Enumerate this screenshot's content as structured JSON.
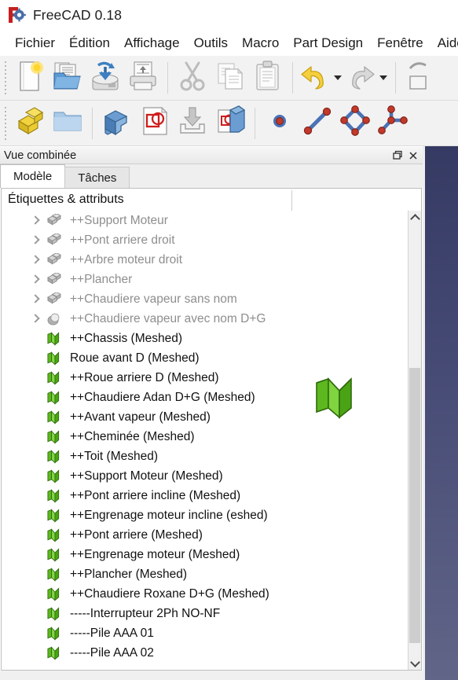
{
  "window": {
    "title": "FreeCAD 0.18",
    "logo_icon": "freecad-logo-icon"
  },
  "menubar": {
    "items": [
      {
        "label": "Fichier"
      },
      {
        "label": "Édition"
      },
      {
        "label": "Affichage"
      },
      {
        "label": "Outils"
      },
      {
        "label": "Macro"
      },
      {
        "label": "Part Design"
      },
      {
        "label": "Fenêtre"
      },
      {
        "label": "Aide"
      }
    ]
  },
  "toolbars": [
    {
      "name": "file-toolbar",
      "buttons": [
        {
          "icon": "new-document-icon",
          "label": "Nouveau",
          "enabled": true
        },
        {
          "icon": "open-folder-icon",
          "label": "Ouvrir",
          "enabled": true
        },
        {
          "icon": "save-disk-icon",
          "label": "Enregistrer",
          "enabled": true
        },
        {
          "icon": "print-icon",
          "label": "Imprimer",
          "enabled": true
        },
        {
          "icon": "cut-scissors-icon",
          "label": "Couper",
          "enabled": false
        },
        {
          "icon": "copy-pages-icon",
          "label": "Copier",
          "enabled": false
        },
        {
          "icon": "paste-clipboard-icon",
          "label": "Coller",
          "enabled": false
        },
        {
          "icon": "undo-arrow-icon",
          "label": "Annuler",
          "enabled": true,
          "dropdown": true
        },
        {
          "icon": "redo-arrow-icon",
          "label": "Rétablir",
          "enabled": false,
          "dropdown": true
        },
        {
          "icon": "refresh-icon",
          "label": "Rafraîchir",
          "enabled": true,
          "clipped": true
        }
      ]
    },
    {
      "name": "workbench-toolbar",
      "buttons": [
        {
          "icon": "yellow-blocks-icon",
          "label": "Créer un corps",
          "enabled": true
        },
        {
          "icon": "blue-folder-icon",
          "label": "Créer un groupe",
          "enabled": true
        },
        {
          "icon": "blue-part-icon",
          "label": "Pièce",
          "enabled": true
        },
        {
          "icon": "sketch-document-icon",
          "label": "Créer une esquisse",
          "enabled": true
        },
        {
          "icon": "import-arrow-icon",
          "label": "Importer",
          "enabled": false
        },
        {
          "icon": "attach-sketch-icon",
          "label": "Attacher une esquisse",
          "enabled": true
        },
        {
          "icon": "point-icon",
          "label": "Point",
          "enabled": true
        },
        {
          "icon": "line-icon",
          "label": "Ligne",
          "enabled": true
        },
        {
          "icon": "polyline-icon",
          "label": "Polyligne",
          "enabled": true
        },
        {
          "icon": "three-point-icon",
          "label": "Arc trois points",
          "enabled": true
        }
      ]
    }
  ],
  "panel": {
    "title": "Vue combinée",
    "float_icon": "restore-icon",
    "close_icon": "close-icon",
    "tabs": [
      {
        "label": "Modèle",
        "active": true
      },
      {
        "label": "Tâches",
        "active": false
      }
    ]
  },
  "tree": {
    "column_header": "Étiquettes & attributs",
    "items": [
      {
        "label": "++Support Moteur",
        "icon": "part-cube-icon",
        "state": "dim",
        "expandable": true
      },
      {
        "label": "++Pont arriere droit",
        "icon": "part-cube-icon",
        "state": "dim",
        "expandable": true
      },
      {
        "label": "++Arbre moteur droit",
        "icon": "part-cube-icon",
        "state": "dim",
        "expandable": true
      },
      {
        "label": "++Plancher",
        "icon": "part-cube-icon",
        "state": "dim",
        "expandable": true
      },
      {
        "label": "++Chaudiere vapeur sans nom",
        "icon": "part-cube-icon",
        "state": "dim",
        "expandable": true
      },
      {
        "label": "++Chaudiere vapeur avec nom D+G",
        "icon": "part-sphere-icon",
        "state": "dim",
        "expandable": true
      },
      {
        "label": "++Chassis (Meshed)",
        "icon": "mesh-icon",
        "state": "normal",
        "expandable": false
      },
      {
        "label": "Roue avant D (Meshed)",
        "icon": "mesh-icon",
        "state": "normal",
        "expandable": false
      },
      {
        "label": "++Roue arriere D (Meshed)",
        "icon": "mesh-icon",
        "state": "normal",
        "expandable": false
      },
      {
        "label": "++Chaudiere Adan D+G (Meshed)",
        "icon": "mesh-icon",
        "state": "normal",
        "expandable": false
      },
      {
        "label": "++Avant vapeur (Meshed)",
        "icon": "mesh-icon",
        "state": "normal",
        "expandable": false
      },
      {
        "label": "++Cheminée (Meshed)",
        "icon": "mesh-icon",
        "state": "normal",
        "expandable": false
      },
      {
        "label": "++Toit (Meshed)",
        "icon": "mesh-icon",
        "state": "normal",
        "expandable": false
      },
      {
        "label": "++Support Moteur (Meshed)",
        "icon": "mesh-icon",
        "state": "normal",
        "expandable": false
      },
      {
        "label": "++Pont arriere incline (Meshed)",
        "icon": "mesh-icon",
        "state": "normal",
        "expandable": false
      },
      {
        "label": "++Engrenage moteur incline (eshed)",
        "icon": "mesh-icon",
        "state": "normal",
        "expandable": false
      },
      {
        "label": "++Pont arriere (Meshed)",
        "icon": "mesh-icon",
        "state": "normal",
        "expandable": false
      },
      {
        "label": "++Engrenage moteur (Meshed)",
        "icon": "mesh-icon",
        "state": "normal",
        "expandable": false
      },
      {
        "label": "++Plancher (Meshed)",
        "icon": "mesh-icon",
        "state": "normal",
        "expandable": false
      },
      {
        "label": "++Chaudiere Roxane D+G (Meshed)",
        "icon": "mesh-icon",
        "state": "normal",
        "expandable": false
      },
      {
        "label": "-----Interrupteur 2Ph NO-NF",
        "icon": "mesh-icon",
        "state": "normal",
        "expandable": false
      },
      {
        "label": "-----Pile AAA 01",
        "icon": "mesh-icon",
        "state": "normal",
        "expandable": false
      },
      {
        "label": "-----Pile AAA 02",
        "icon": "mesh-icon",
        "state": "normal",
        "expandable": false
      }
    ]
  },
  "drag_ghost": {
    "icon": "mesh-drag-icon"
  },
  "scrollbar": {
    "up_icon": "chevron-up-icon",
    "down_icon": "chevron-down-icon"
  },
  "colors": {
    "mesh_green": "#4fae1e",
    "accent_dim_text": "#8e8e8e",
    "text": "#111111",
    "viewport_bg_top": "#353a63",
    "viewport_bg_bottom": "#616587",
    "toolbar_bg": "#f2f2f2"
  }
}
